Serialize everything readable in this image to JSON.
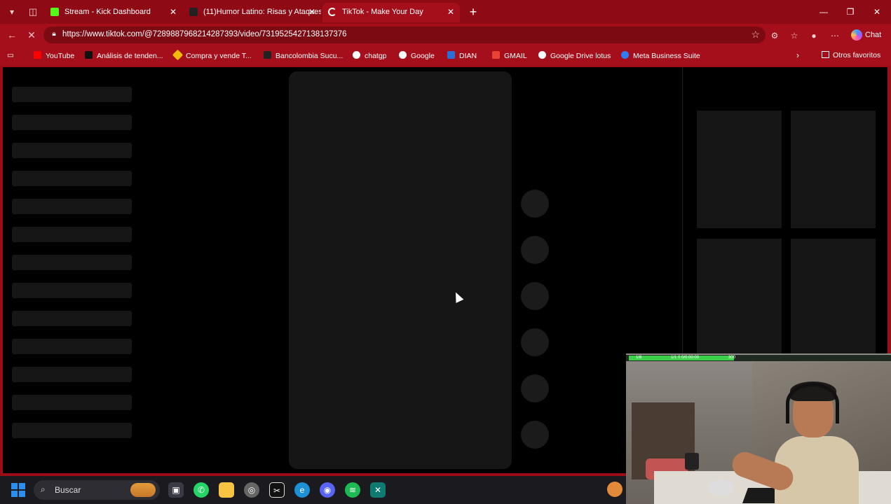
{
  "browser": {
    "tabs": [
      {
        "label": "Stream - Kick Dashboard",
        "favicon_color": "#53fc18",
        "icon": "kick-icon"
      },
      {
        "label": "(11)Humor Latino: Risas y Ataques",
        "favicon_color": "#ffffff",
        "icon": "tiktok-icon"
      },
      {
        "label": "TikTok - Make Your Day",
        "favicon_color": "#ffffff",
        "icon": "loading-icon"
      }
    ],
    "url": "https://www.tiktok.com/@7289887968214287393/video/7319525427138137376",
    "chat_label": "Chat",
    "bookmarks": [
      {
        "label": "YouTube",
        "icon": "youtube-icon",
        "color": "#ff0000"
      },
      {
        "label": "Análisis de tenden...",
        "icon": "tv-icon",
        "color": "#000000"
      },
      {
        "label": "Compra y vende T...",
        "icon": "binance-icon",
        "color": "#f0b90b"
      },
      {
        "label": "Bancolombia Sucu...",
        "icon": "bancolombia-icon",
        "color": "#ffffff"
      },
      {
        "label": "chatgp",
        "icon": "chatgpt-icon",
        "color": "#ffffff"
      },
      {
        "label": "Google",
        "icon": "google-icon",
        "color": "#ffffff"
      },
      {
        "label": "DIAN",
        "icon": "dian-icon",
        "color": "#2a6fd6"
      },
      {
        "label": "GMAIL",
        "icon": "gmail-icon",
        "color": "#ea4335"
      },
      {
        "label": "Google Drive lotus",
        "icon": "google-icon",
        "color": "#ffffff"
      },
      {
        "label": "Meta Business Suite",
        "icon": "meta-icon",
        "color": "#2d7ff9"
      }
    ],
    "other_bookmarks": "Otros favoritos"
  },
  "colors": {
    "frame": "#9c0d18",
    "skeleton": "#161616",
    "page_bg": "#000000"
  },
  "taskbar": {
    "search_label": "Buscar",
    "apps": [
      {
        "name": "task-view-icon",
        "color": "#3a3a44"
      },
      {
        "name": "whatsapp-icon",
        "color": "#25d366"
      },
      {
        "name": "file-explorer-icon",
        "color": "#f6c343"
      },
      {
        "name": "chrome-icon",
        "color": "#888888"
      },
      {
        "name": "capcut-icon",
        "color": "#111111"
      },
      {
        "name": "edge-icon",
        "color": "#1e90d6"
      },
      {
        "name": "discord-icon",
        "color": "#5865f2"
      },
      {
        "name": "spotify-icon",
        "color": "#1db954"
      },
      {
        "name": "app-x-icon",
        "color": "#0f7a6f"
      }
    ]
  },
  "webcam": {
    "overlay_left": "1/8",
    "overlay_mid": "1/1 0 0/0:00:00",
    "overlay_right": "300"
  }
}
